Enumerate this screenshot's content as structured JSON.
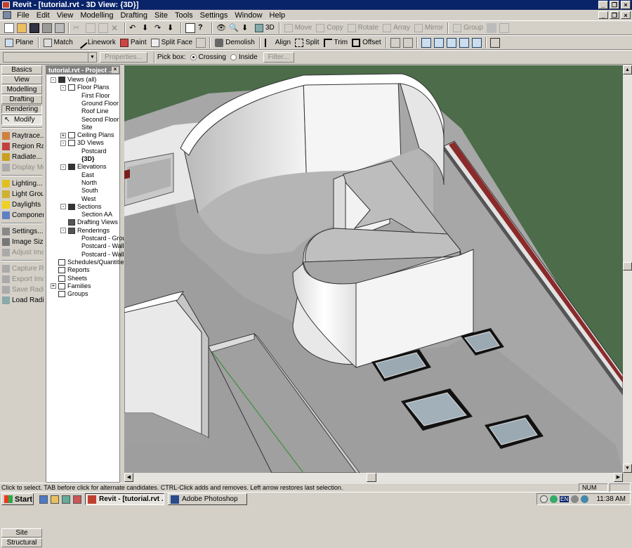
{
  "window": {
    "title": "Revit - [tutorial.rvt - 3D View: {3D}]"
  },
  "menu": [
    "File",
    "Edit",
    "View",
    "Modelling",
    "Drafting",
    "Site",
    "Tools",
    "Settings",
    "Window",
    "Help"
  ],
  "toolbar1": {
    "move": "Move",
    "copy": "Copy",
    "rotate": "Rotate",
    "array": "Array",
    "mirror": "Mirror",
    "group": "Group",
    "view3d": "3D"
  },
  "toolbar2": {
    "plane": "Plane",
    "match": "Match",
    "linework": "Linework",
    "paint": "Paint",
    "split_face": "Split Face",
    "demolish": "Demolish",
    "align": "Align",
    "split": "Split",
    "trim": "Trim",
    "offset": "Offset"
  },
  "toolbar3": {
    "properties": "Properties...",
    "pick_box": "Pick box:",
    "crossing": "Crossing",
    "inside": "Inside",
    "filter": "Filter..."
  },
  "design_bar": {
    "tabs": [
      "Basics",
      "View",
      "Modelling",
      "Drafting",
      "Rendering"
    ],
    "modify": "Modify",
    "tools": [
      {
        "label": "Raytrace...",
        "enabled": true
      },
      {
        "label": "Region Raytr",
        "enabled": true
      },
      {
        "label": "Radiate...",
        "enabled": true
      },
      {
        "label": "Display Mode",
        "enabled": false
      },
      {
        "label": "Lighting...",
        "enabled": true
      },
      {
        "label": "Light Groups",
        "enabled": true
      },
      {
        "label": "Daylights",
        "enabled": true
      },
      {
        "label": "Component",
        "enabled": true
      },
      {
        "label": "Settings...",
        "enabled": true
      },
      {
        "label": "Image Size...",
        "enabled": true
      },
      {
        "label": "Adjust Image",
        "enabled": false
      },
      {
        "label": "Capture Ren",
        "enabled": false
      },
      {
        "label": "Export Imag",
        "enabled": false
      },
      {
        "label": "Save Radios",
        "enabled": false
      },
      {
        "label": "Load Radiosi",
        "enabled": true
      }
    ],
    "bottom_tabs": [
      "Site",
      "Structural"
    ]
  },
  "browser": {
    "title": "tutorial.rvt - Project ...",
    "nodes": [
      {
        "label": "Views (all)",
        "depth": 0,
        "exp": "-",
        "icon": "eye"
      },
      {
        "label": "Floor Plans",
        "depth": 1,
        "exp": "-",
        "icon": "plan"
      },
      {
        "label": "First Floor",
        "depth": 2
      },
      {
        "label": "Ground Floor",
        "depth": 2
      },
      {
        "label": "Roof Line",
        "depth": 2
      },
      {
        "label": "Second Floor",
        "depth": 2
      },
      {
        "label": "Site",
        "depth": 2
      },
      {
        "label": "Ceiling Plans",
        "depth": 1,
        "exp": "+",
        "icon": "plan"
      },
      {
        "label": "3D Views",
        "depth": 1,
        "exp": "-",
        "icon": "cube"
      },
      {
        "label": "Postcard",
        "depth": 2
      },
      {
        "label": "{3D}",
        "depth": 2,
        "bold": true
      },
      {
        "label": "Elevations",
        "depth": 1,
        "exp": "-",
        "icon": "elev"
      },
      {
        "label": "East",
        "depth": 2
      },
      {
        "label": "North",
        "depth": 2
      },
      {
        "label": "South",
        "depth": 2
      },
      {
        "label": "West",
        "depth": 2
      },
      {
        "label": "Sections",
        "depth": 1,
        "exp": "-",
        "icon": "elev"
      },
      {
        "label": "Section AA",
        "depth": 2
      },
      {
        "label": "Drafting Views",
        "depth": 1,
        "icon": "pen"
      },
      {
        "label": "Renderings",
        "depth": 1,
        "exp": "-",
        "icon": "pen"
      },
      {
        "label": "Postcard - Grou",
        "depth": 2
      },
      {
        "label": "Postcard - Wall",
        "depth": 2
      },
      {
        "label": "Postcard - Wall",
        "depth": 2
      },
      {
        "label": "Schedules/Quantitie",
        "depth": 0,
        "icon": "grid"
      },
      {
        "label": "Reports",
        "depth": 0,
        "icon": "doc"
      },
      {
        "label": "Sheets",
        "depth": 0,
        "icon": "doc"
      },
      {
        "label": "Families",
        "depth": 0,
        "exp": "+",
        "icon": "grid"
      },
      {
        "label": "Groups",
        "depth": 0,
        "icon": "group"
      }
    ]
  },
  "status": {
    "text": "Click to select. TAB before click for alternate candidates. CTRL-Click adds and removes. Left arrow restores last selection.",
    "num": "NUM"
  },
  "taskbar": {
    "start": "Start",
    "tasks": [
      "Revit - [tutorial.rvt ...",
      "Adobe Photoshop"
    ],
    "lang": "EN",
    "clock": "11:38 AM"
  }
}
